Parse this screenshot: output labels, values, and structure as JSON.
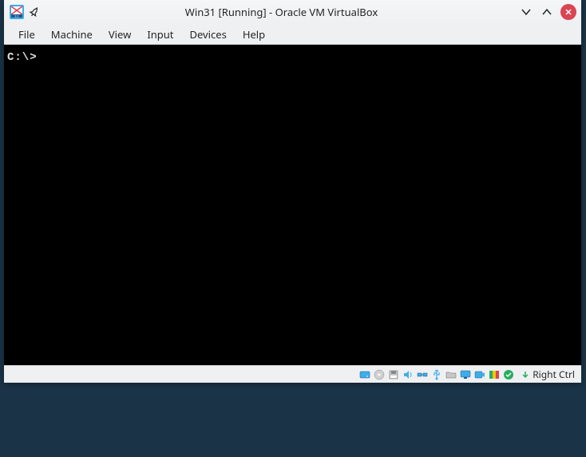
{
  "titlebar": {
    "title": "Win31 [Running] - Oracle VM VirtualBox"
  },
  "menubar": {
    "items": [
      {
        "label": "File"
      },
      {
        "label": "Machine"
      },
      {
        "label": "View"
      },
      {
        "label": "Input"
      },
      {
        "label": "Devices"
      },
      {
        "label": "Help"
      }
    ]
  },
  "vm": {
    "prompt": "C:\\>"
  },
  "statusbar": {
    "host_key": "Right Ctrl"
  }
}
